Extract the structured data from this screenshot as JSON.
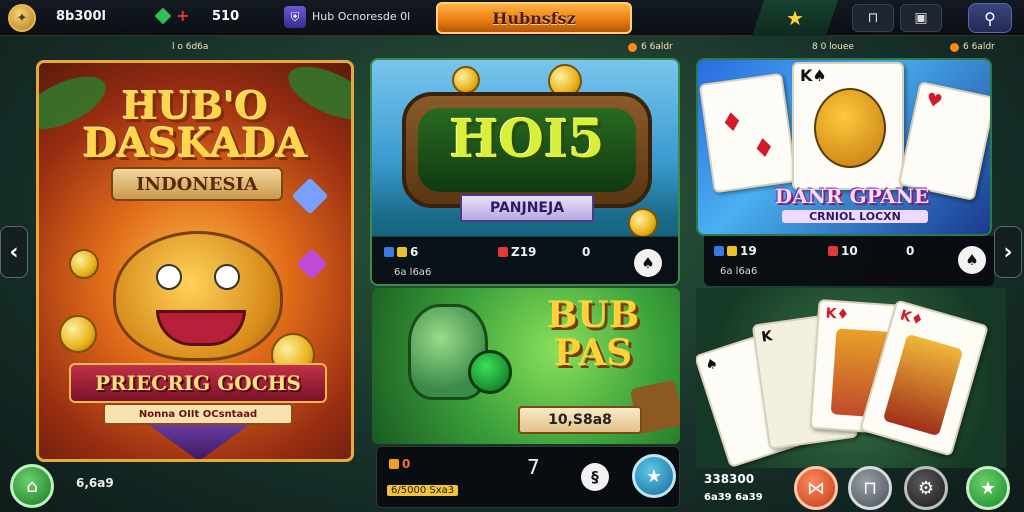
{
  "topbar": {
    "balance": "8b300l",
    "count": "510",
    "channel": "Hub Ocnoresde 0l",
    "brand": "Hubnsfsz",
    "avatar_icon": "crest-icon",
    "colors": {
      "brand": "#e97a10",
      "gem": "#2fbf55",
      "star": "#ffd23a"
    }
  },
  "section_labels": [
    "l o 6d6a",
    "6 6aldr",
    "8 0 louee",
    "6 6aldr"
  ],
  "card1": {
    "title_line1": "HUB'O",
    "title_line2": "DASKADA",
    "banner": "INDONESIA",
    "ribbon": "PRIECRIG GOCHS",
    "ribbon_sub": "Nonna OIIt OCsntaad"
  },
  "card2": {
    "title": "HOI5",
    "banner": "PANJNEJA",
    "stat_a": "6",
    "stat_b": "Z19",
    "stat_c": "0",
    "sub": "6a l6a6"
  },
  "card3": {
    "title_line1": "BUB",
    "title_line2": "PAS",
    "value": "10,S8a8",
    "stat_a": "0",
    "stat_b": "7",
    "sub": "6/5000 Sxa3"
  },
  "card4": {
    "title": "DANR GPANE",
    "subtitle": "CRNIOL LOCXN",
    "stat_a": "19",
    "stat_b": "10",
    "stat_c": "0",
    "sub": "6a l6a6"
  },
  "card5": {
    "stat_a": "338300",
    "sub": "6a39 6a39"
  },
  "home": {
    "balance": "6,6a9"
  },
  "nav": {
    "prev": "‹",
    "next": "›"
  }
}
